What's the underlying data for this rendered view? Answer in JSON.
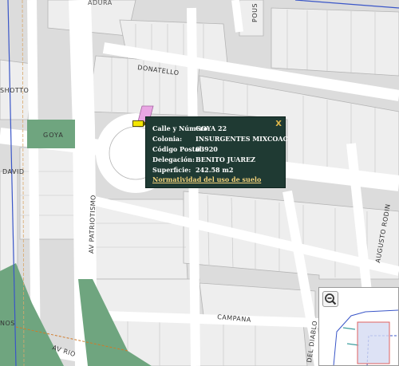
{
  "streets": {
    "top_left": "ADURA",
    "top_vertical": "POUS",
    "donatello": "DONATELLO",
    "left_top": "SHOTTO",
    "goya": "GOYA",
    "david": "DAVID",
    "patriotismo": "AV PATRIOTISMO",
    "augusto": "AUGUSTO RODIN",
    "campana": "CAMPANA",
    "nos": "NOS",
    "av_rio": "AV RIO",
    "del_diablo": "DEL DIABLO"
  },
  "popup": {
    "calle_label": "Calle y Número:",
    "calle_value": "GOYA 22",
    "colonia_label": "Colonia:",
    "colonia_value": "INSURGENTES MIXCOAC",
    "cp_label": "Código Postal:",
    "cp_value": "03920",
    "delegacion_label": "Delegación:",
    "delegacion_value": "BENITO JUAREZ",
    "superficie_label": "Superficie:",
    "superficie_value": "242.58 m2",
    "link": "Normatividad del uso de suelo",
    "close": "X"
  },
  "icons": {
    "close": "close-icon",
    "zoom_out": "zoom-out-icon",
    "marker": "location-marker-icon"
  },
  "colors": {
    "popup_bg": "#1f3a33",
    "link": "#f2d27a",
    "park": "#6fa57f",
    "parcel_highlight": "#e9a6e3",
    "overview_extent": "#d5dbf2",
    "boundary": "#3a56c8"
  }
}
